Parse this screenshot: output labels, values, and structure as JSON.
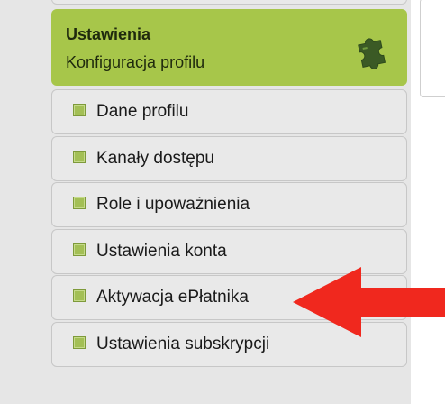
{
  "sidebar": {
    "header": {
      "title": "Ustawienia",
      "subtitle": "Konfiguracja profilu",
      "icon": "puzzle-icon",
      "background_color": "#a7c64a"
    },
    "items": [
      {
        "label": "Dane profilu"
      },
      {
        "label": "Kanały dostępu"
      },
      {
        "label": "Role i upoważnienia"
      },
      {
        "label": "Ustawienia konta"
      },
      {
        "label": "Aktywacja ePłatnika"
      },
      {
        "label": "Ustawienia subskrypcji"
      }
    ]
  },
  "annotation": {
    "arrow_color": "#f0281e",
    "points_to_item": "Aktywacja ePłatnika"
  }
}
